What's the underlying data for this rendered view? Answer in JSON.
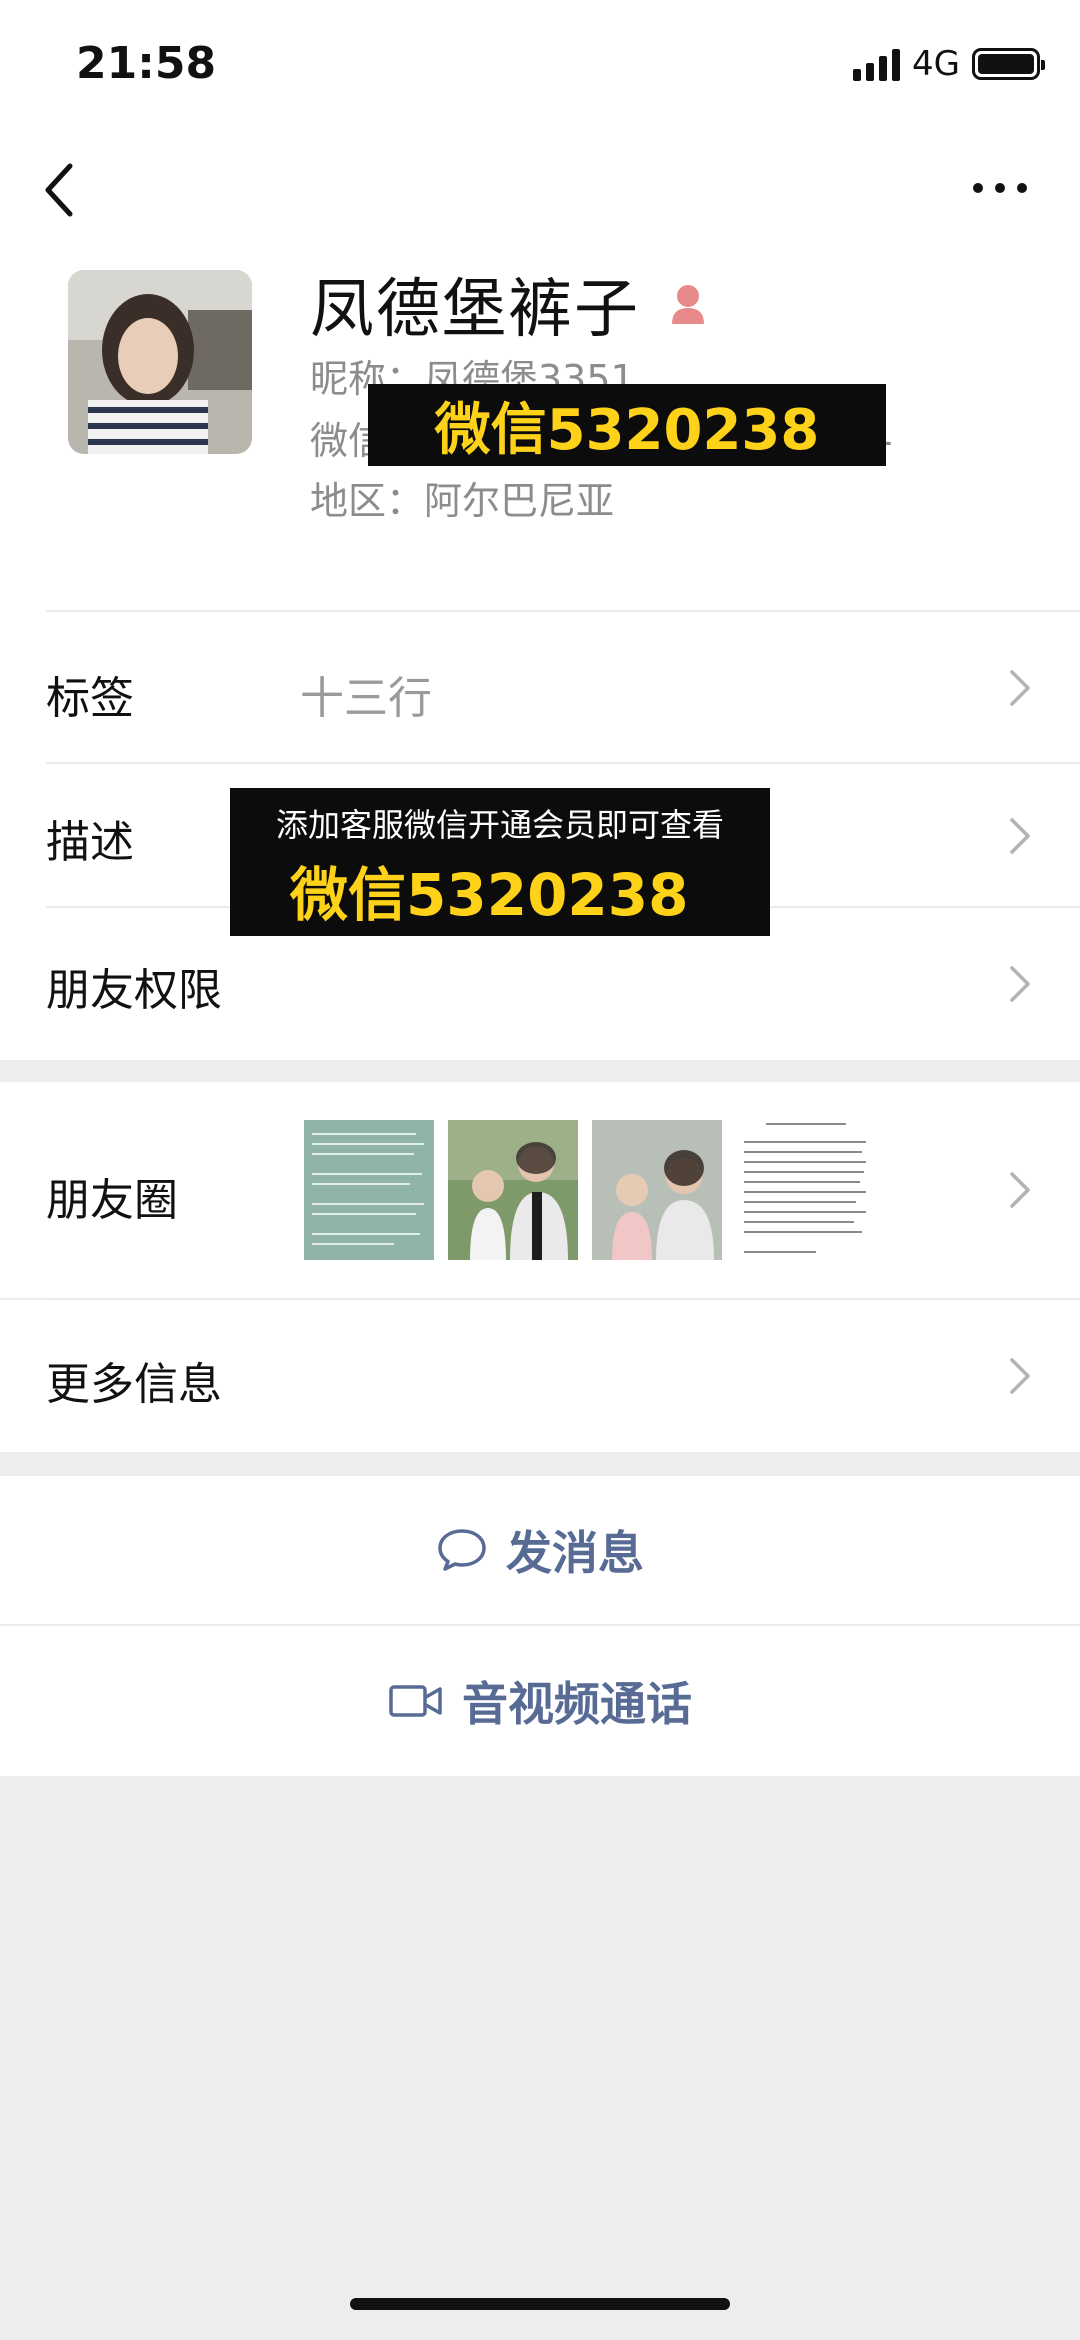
{
  "status_bar": {
    "time": "21:58",
    "network": "4G"
  },
  "profile": {
    "name": "凤德堡裤子",
    "nickname": "昵称：凤德堡3351",
    "wechat_id": "微信号：",
    "wechat_id_tail": "1",
    "region": "地区：阿尔巴尼亚"
  },
  "rows": {
    "tag_label": "标签",
    "tag_value": "十三行",
    "desc_label": "描述",
    "permission_label": "朋友权限",
    "moments_label": "朋友圈",
    "more_label": "更多信息"
  },
  "actions": {
    "message": "发消息",
    "call": "音视频通话"
  },
  "overlays": {
    "top_text": "微信5320238",
    "middle_sub": "添加客服微信开通会员即可查看",
    "middle_main": "微信5320238"
  },
  "colors": {
    "link": "#576b95",
    "overlay_yellow": "#ffd21a",
    "background": "#ededed"
  }
}
